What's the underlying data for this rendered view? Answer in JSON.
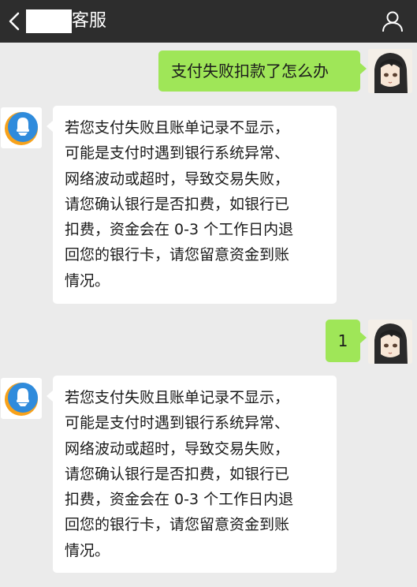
{
  "header": {
    "title_suffix": "客服"
  },
  "messages": [
    {
      "from": "user",
      "text": "支付失败扣款了怎么办"
    },
    {
      "from": "bot",
      "lines": [
        "若您支付失败且账单记录不显示，",
        "可能是支付时遇到银行系统异常、",
        "网络波动或超时，导致交易失败，",
        "请您确认银行是否扣费，如银行已",
        "扣费，资金会在 0-3 个工作日内退",
        "回您的银行卡，请您留意资金到账",
        "情况。"
      ]
    },
    {
      "from": "user",
      "text": "1"
    },
    {
      "from": "bot",
      "lines": [
        "若您支付失败且账单记录不显示，",
        "可能是支付时遇到银行系统异常、",
        "网络波动或超时，导致交易失败，",
        "请您确认银行是否扣费，如银行已",
        "扣费，资金会在 0-3 个工作日内退",
        "回您的银行卡，请您留意资金到账",
        "情况。"
      ]
    }
  ],
  "colors": {
    "header_bg": "#2d2d2d",
    "chat_bg": "#ebebeb",
    "bubble_out": "#9fe658",
    "bubble_in": "#ffffff"
  }
}
